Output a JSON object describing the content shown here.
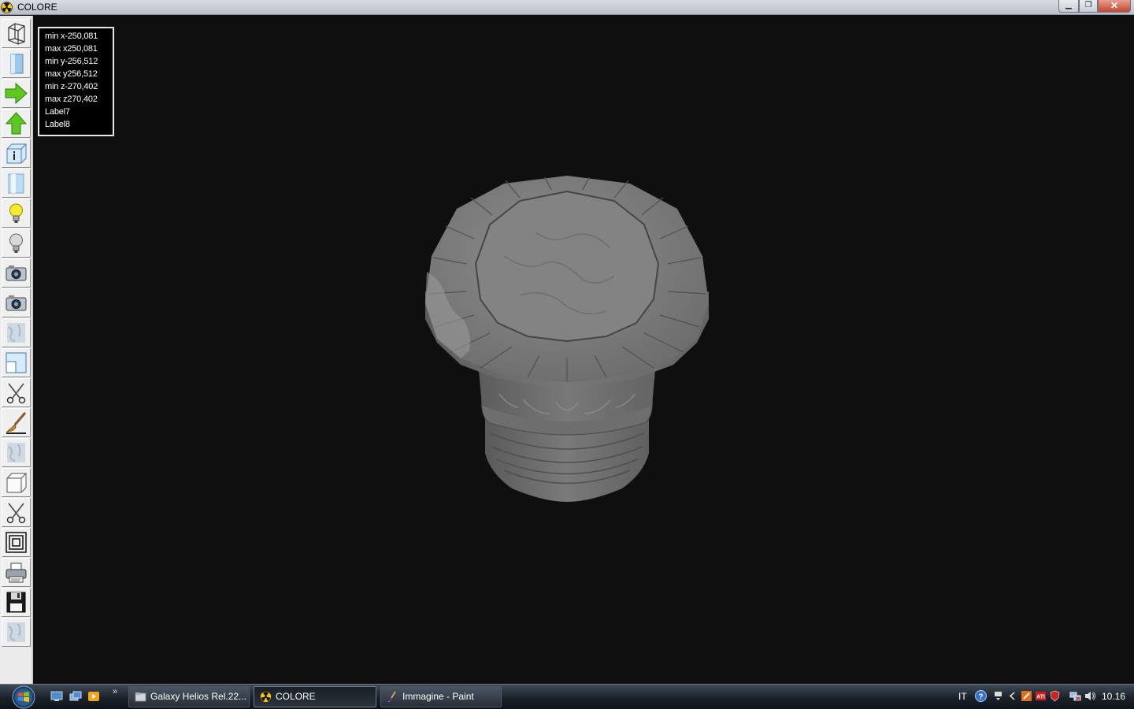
{
  "window": {
    "title": "COLORE",
    "minimize_glyph": "▁",
    "maximize_glyph": "❐",
    "close_glyph": "✕"
  },
  "toolbar": {
    "tools": [
      {
        "name": "wireframe-tool",
        "icon": "wireframe-box-icon"
      },
      {
        "name": "solid-tool",
        "icon": "blue-cylinder-icon"
      },
      {
        "name": "move-right-tool",
        "icon": "green-arrow-right-icon"
      },
      {
        "name": "move-up-tool",
        "icon": "green-arrow-up-icon"
      },
      {
        "name": "info-box-tool",
        "icon": "info-cube-icon"
      },
      {
        "name": "cylinder-tool",
        "icon": "light-cylinder-icon"
      },
      {
        "name": "light-on-tool",
        "icon": "light-bulb-on-icon"
      },
      {
        "name": "light-off-tool",
        "icon": "light-bulb-off-icon"
      },
      {
        "name": "camera-1-tool",
        "icon": "camera-icon"
      },
      {
        "name": "camera-2-tool",
        "icon": "camera-icon"
      },
      {
        "name": "texture-1-tool",
        "icon": "marble-texture-icon"
      },
      {
        "name": "viewport-tool",
        "icon": "split-view-icon"
      },
      {
        "name": "cut-1-tool",
        "icon": "scissors-icon"
      },
      {
        "name": "paint-tool",
        "icon": "paint-brush-icon"
      },
      {
        "name": "texture-2-tool",
        "icon": "marble-texture-icon"
      },
      {
        "name": "cube-tool",
        "icon": "white-cube-icon"
      },
      {
        "name": "cut-2-tool",
        "icon": "scissors-icon"
      },
      {
        "name": "frame-tool",
        "icon": "concentric-squares-icon"
      },
      {
        "name": "print-tool",
        "icon": "printer-icon"
      },
      {
        "name": "save-tool",
        "icon": "floppy-disk-icon"
      },
      {
        "name": "texture-3-tool",
        "icon": "marble-texture-icon"
      }
    ]
  },
  "info": {
    "lines": [
      "min x-250,081",
      "max x250,081",
      "min y-256,512",
      "max y256,512",
      "min z-270,402",
      "max z270,402",
      "Label7",
      "Label8"
    ]
  },
  "taskbar": {
    "quick_launch_more": "»",
    "tasks": [
      {
        "label": "Galaxy Helios  Rel.22...",
        "icon": "explorer-folder-icon",
        "active": false
      },
      {
        "label": "COLORE",
        "icon": "radiation-icon",
        "active": true
      },
      {
        "label": "Immagine - Paint",
        "icon": "paint-icon",
        "active": false
      }
    ],
    "tray": {
      "language": "IT",
      "clock": "10.16"
    }
  }
}
